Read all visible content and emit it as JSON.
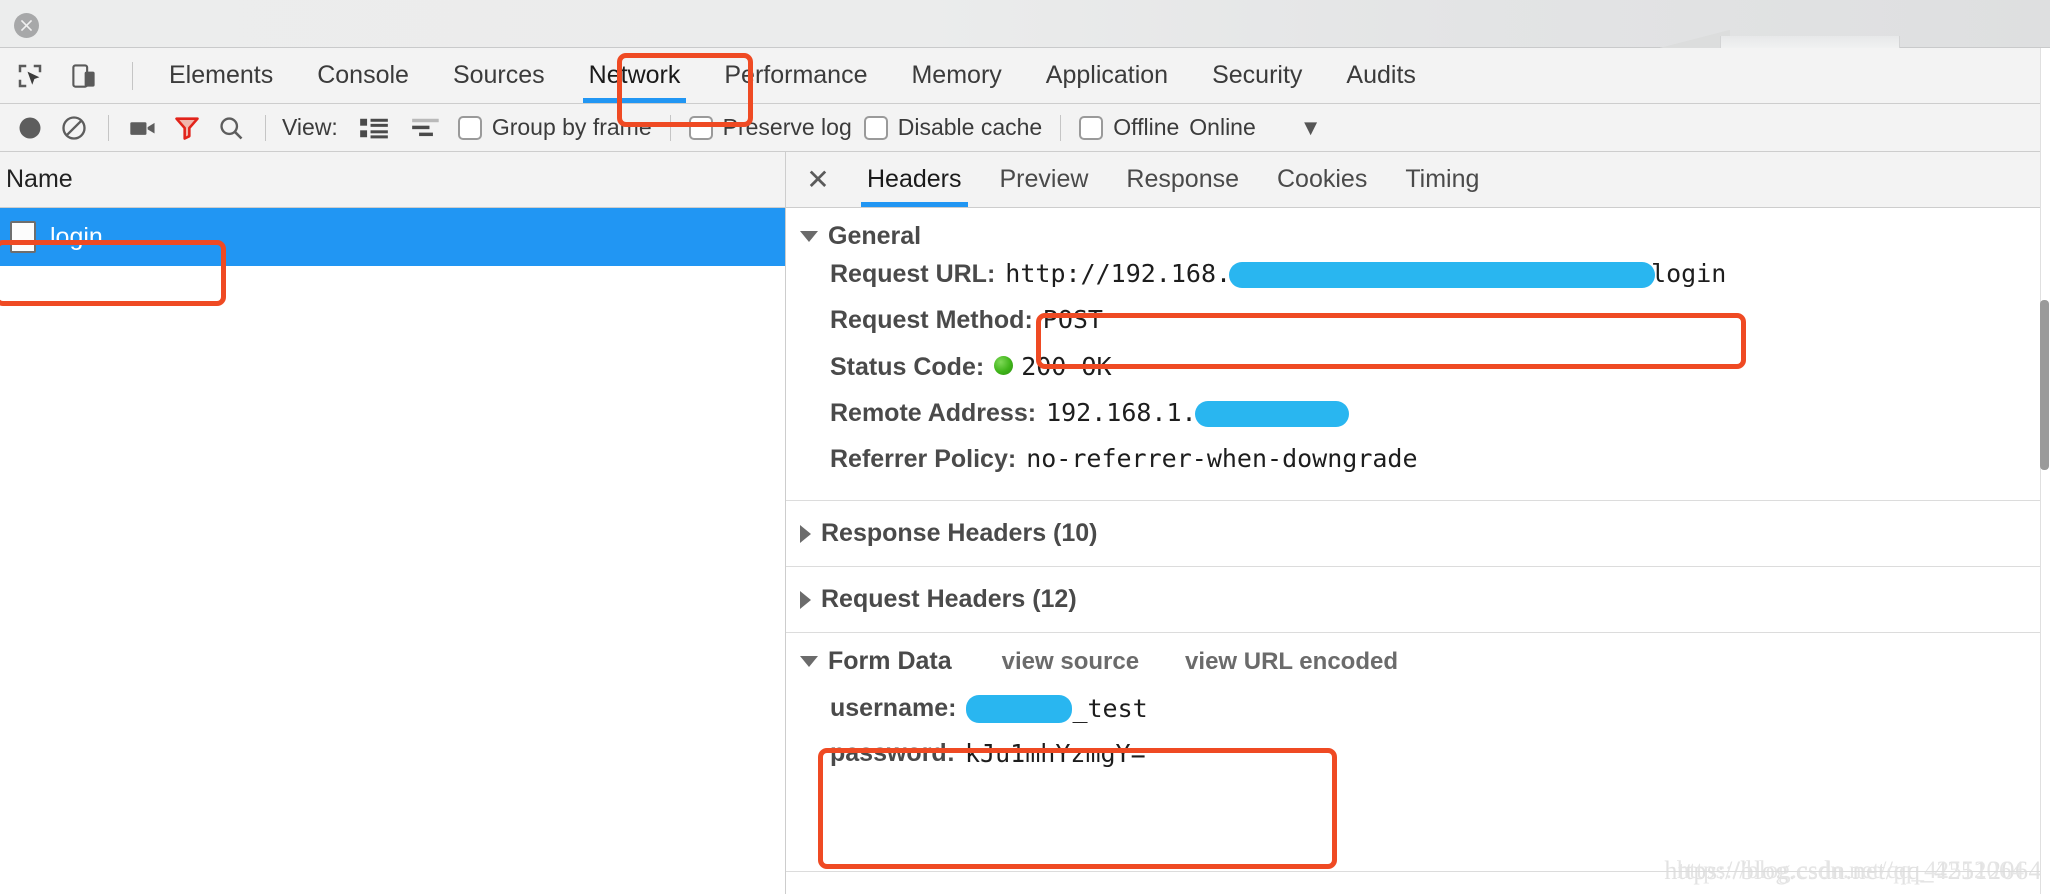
{
  "window": {
    "close_icon": "close-circle-icon"
  },
  "devtools_tabs": {
    "inspect_icon": "inspect-element-icon",
    "device_icon": "toggle-device-toolbar-icon",
    "items": [
      {
        "label": "Elements",
        "active": false
      },
      {
        "label": "Console",
        "active": false
      },
      {
        "label": "Sources",
        "active": false
      },
      {
        "label": "Network",
        "active": true
      },
      {
        "label": "Performance",
        "active": false
      },
      {
        "label": "Memory",
        "active": false
      },
      {
        "label": "Application",
        "active": false
      },
      {
        "label": "Security",
        "active": false
      },
      {
        "label": "Audits",
        "active": false
      }
    ]
  },
  "network_toolbar": {
    "record_icon": "record-circle-icon",
    "clear_icon": "clear-prohibited-icon",
    "screenshot_icon": "camera-icon",
    "filter_icon": "funnel-filter-icon",
    "search_icon": "magnifier-search-icon",
    "view_label": "View:",
    "view_list_icon": "list-view-icon",
    "view_waterfall_icon": "waterfall-view-icon",
    "group_by_frame_label": "Group by frame",
    "preserve_log_label": "Preserve log",
    "disable_cache_label": "Disable cache",
    "offline_label": "Offline",
    "throttle_value": "Online",
    "throttle_caret_icon": "chevron-down-icon"
  },
  "request_list": {
    "column_header": "Name",
    "rows": [
      {
        "name": "login",
        "icon": "document-file-icon",
        "selected": true
      }
    ]
  },
  "detail_panel": {
    "close_icon": "close-x-icon",
    "tabs": [
      {
        "label": "Headers",
        "active": true
      },
      {
        "label": "Preview",
        "active": false
      },
      {
        "label": "Response",
        "active": false
      },
      {
        "label": "Cookies",
        "active": false
      },
      {
        "label": "Timing",
        "active": false
      }
    ],
    "general": {
      "title": "General",
      "expanded": true,
      "rows": [
        {
          "key": "Request URL:",
          "value_prefix": "http://192.168.",
          "redacted": true,
          "value_suffix": "login"
        },
        {
          "key": "Request Method:",
          "value": "POST"
        },
        {
          "key": "Status Code:",
          "value": "200 OK",
          "status_dot": "green-status-dot"
        },
        {
          "key": "Remote Address:",
          "value_prefix": "192.168.1.",
          "redacted": true,
          "value_suffix": ""
        },
        {
          "key": "Referrer Policy:",
          "value": "no-referrer-when-downgrade"
        }
      ]
    },
    "response_headers": {
      "title": "Response Headers (10)",
      "expanded": false
    },
    "request_headers": {
      "title": "Request Headers (12)",
      "expanded": false
    },
    "form_data": {
      "title": "Form Data",
      "expanded": true,
      "view_source_label": "view source",
      "view_url_encoded_label": "view URL encoded",
      "rows": [
        {
          "key": "username:",
          "redacted": true,
          "value_suffix": "_test"
        },
        {
          "key": "password:",
          "value": "kJu1mhYzmgY="
        }
      ]
    }
  },
  "annotations": {
    "highlight_color": "#ef4a23",
    "redact_color": "#29b6f0",
    "accent_color": "#2196f3",
    "boxes": [
      "network-tab-box",
      "login-row-box",
      "request-url-box",
      "form-data-values-box"
    ]
  },
  "watermark": {
    "text_a": "https://blog.csdn.net/qq_42512064",
    "text_b": "https://blog.csdn.net/qq_42512064"
  }
}
